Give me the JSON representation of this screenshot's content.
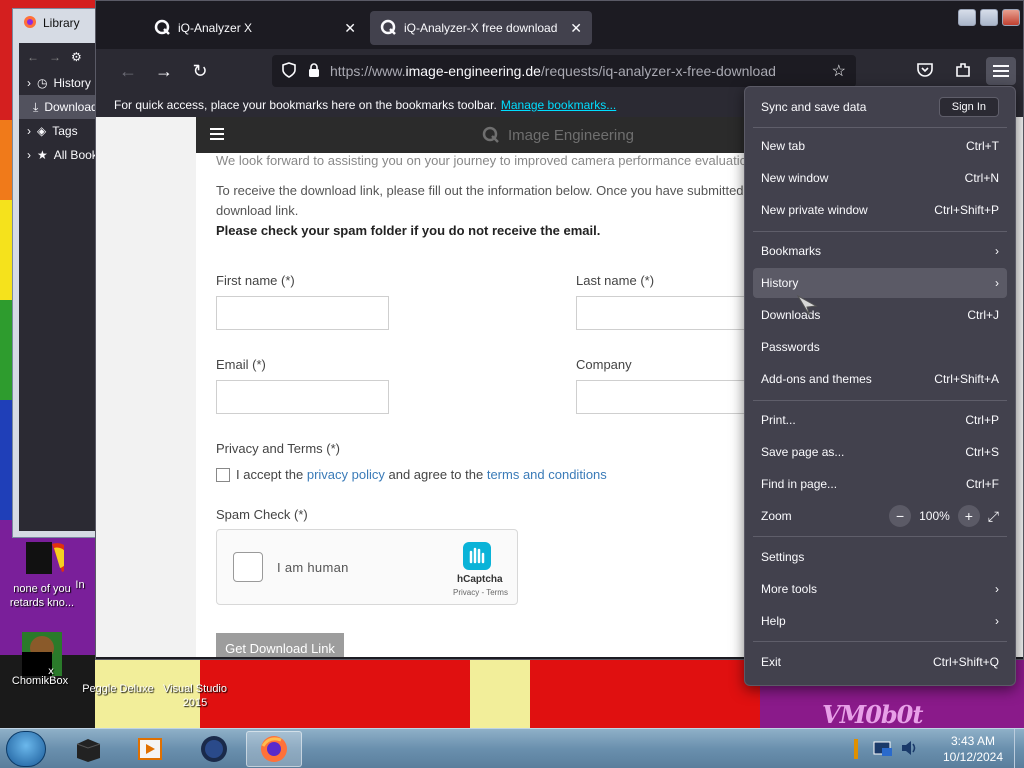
{
  "desktop": {
    "icons": [
      {
        "label": "none of you retards kno..."
      },
      {
        "label": "In"
      },
      {
        "label": "ChomikBox"
      },
      {
        "label": "Peggle Deluxe"
      },
      {
        "label": "Visual Studio 2015"
      }
    ],
    "wallpaper_text": "VM0b0t"
  },
  "library": {
    "title": "Library",
    "items": [
      {
        "label": "History"
      },
      {
        "label": "Downloads"
      },
      {
        "label": "Tags"
      },
      {
        "label": "All Bookmarks"
      }
    ]
  },
  "browser": {
    "tabs": [
      {
        "title": "iQ-Analyzer X",
        "active": false
      },
      {
        "title": "iQ-Analyzer-X free download",
        "active": true
      }
    ],
    "url_prefix": "https://www.",
    "url_domain": "image-engineering.de",
    "url_path": "/requests/iq-analyzer-x-free-download",
    "bookmarks_hint": "For quick access, place your bookmarks here on the bookmarks toolbar.",
    "manage_bookmarks": "Manage bookmarks..."
  },
  "page": {
    "brand": "Image Engineering",
    "intro_line": "We look forward to assisting you on your journey to improved camera performance evaluations.",
    "info_line1": "To receive the download link, please fill out the information below. Once you have submitted this fo",
    "info_line2": "download link.",
    "spam_warning": "Please check your spam folder if you do not receive the email.",
    "first_name_label": "First name (*)",
    "last_name_label": "Last name (*)",
    "email_label": "Email (*)",
    "company_label": "Company",
    "privacy_label": "Privacy and Terms (*)",
    "accept_prefix": "I accept the",
    "privacy_link": "privacy policy",
    "accept_middle": "and agree to the",
    "terms_link": "terms and conditions",
    "spam_check_label": "Spam Check (*)",
    "captcha_text": "I am human",
    "captcha_brand": "hCaptcha",
    "captcha_sub": "Privacy - Terms",
    "submit": "Get Download Link"
  },
  "menu": {
    "sync": "Sync and save data",
    "sign_in": "Sign In",
    "items": [
      {
        "label": "New tab",
        "shortcut": "Ctrl+T"
      },
      {
        "label": "New window",
        "shortcut": "Ctrl+N"
      },
      {
        "label": "New private window",
        "shortcut": "Ctrl+Shift+P"
      },
      {
        "label": "Bookmarks",
        "shortcut": ""
      },
      {
        "label": "History",
        "shortcut": ""
      },
      {
        "label": "Downloads",
        "shortcut": "Ctrl+J"
      },
      {
        "label": "Passwords",
        "shortcut": ""
      },
      {
        "label": "Add-ons and themes",
        "shortcut": "Ctrl+Shift+A"
      },
      {
        "label": "Print...",
        "shortcut": "Ctrl+P"
      },
      {
        "label": "Save page as...",
        "shortcut": "Ctrl+S"
      },
      {
        "label": "Find in page...",
        "shortcut": "Ctrl+F"
      },
      {
        "label": "Zoom",
        "shortcut": ""
      },
      {
        "label": "Settings",
        "shortcut": ""
      },
      {
        "label": "More tools",
        "shortcut": ""
      },
      {
        "label": "Help",
        "shortcut": ""
      },
      {
        "label": "Exit",
        "shortcut": "Ctrl+Shift+Q"
      }
    ],
    "zoom_minus": "−",
    "zoom_value": "100%",
    "zoom_plus": "+"
  },
  "taskbar": {
    "time": "3:43 AM",
    "date": "10/12/2024"
  },
  "colors": {
    "menu_bg": "#42414d",
    "link": "#3a7bb8",
    "bookmark_link": "#00ddff"
  }
}
